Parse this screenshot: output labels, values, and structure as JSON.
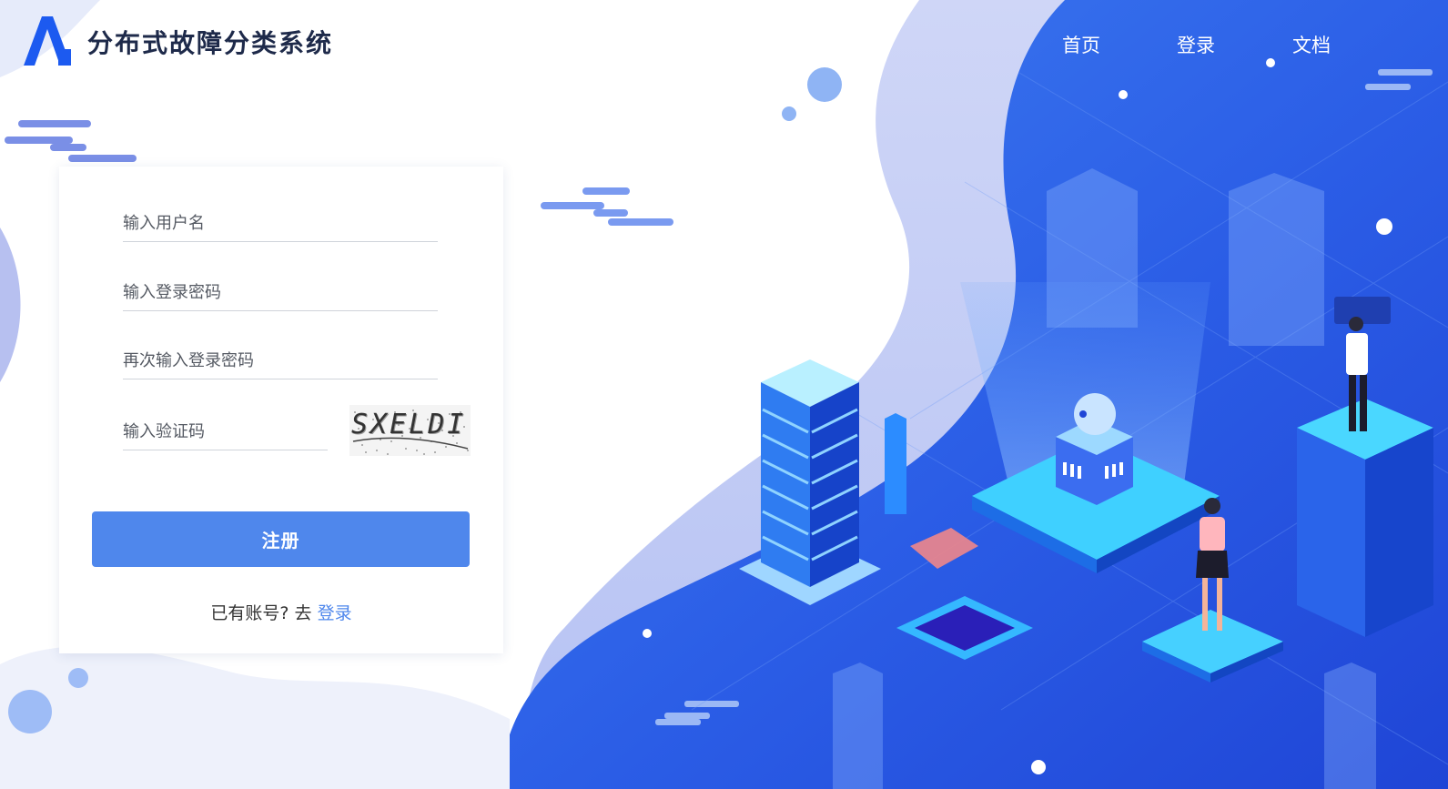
{
  "header": {
    "app_title": "分布式故障分类系统",
    "nav": {
      "home": "首页",
      "login": "登录",
      "docs": "文档"
    }
  },
  "form": {
    "username_placeholder": "输入用户名",
    "password_placeholder": "输入登录密码",
    "confirm_placeholder": "再次输入登录密码",
    "captcha_placeholder": "输入验证码",
    "captcha_text": "SXELDI",
    "register_label": "注册",
    "footer_prefix": "已有账号? 去",
    "footer_link": "登录"
  },
  "colors": {
    "accent": "#4f87ec",
    "hero_blue": "#2d62ea",
    "logo_blue": "#1c5af0"
  },
  "icons": {
    "logo": "a-shape-logo"
  }
}
